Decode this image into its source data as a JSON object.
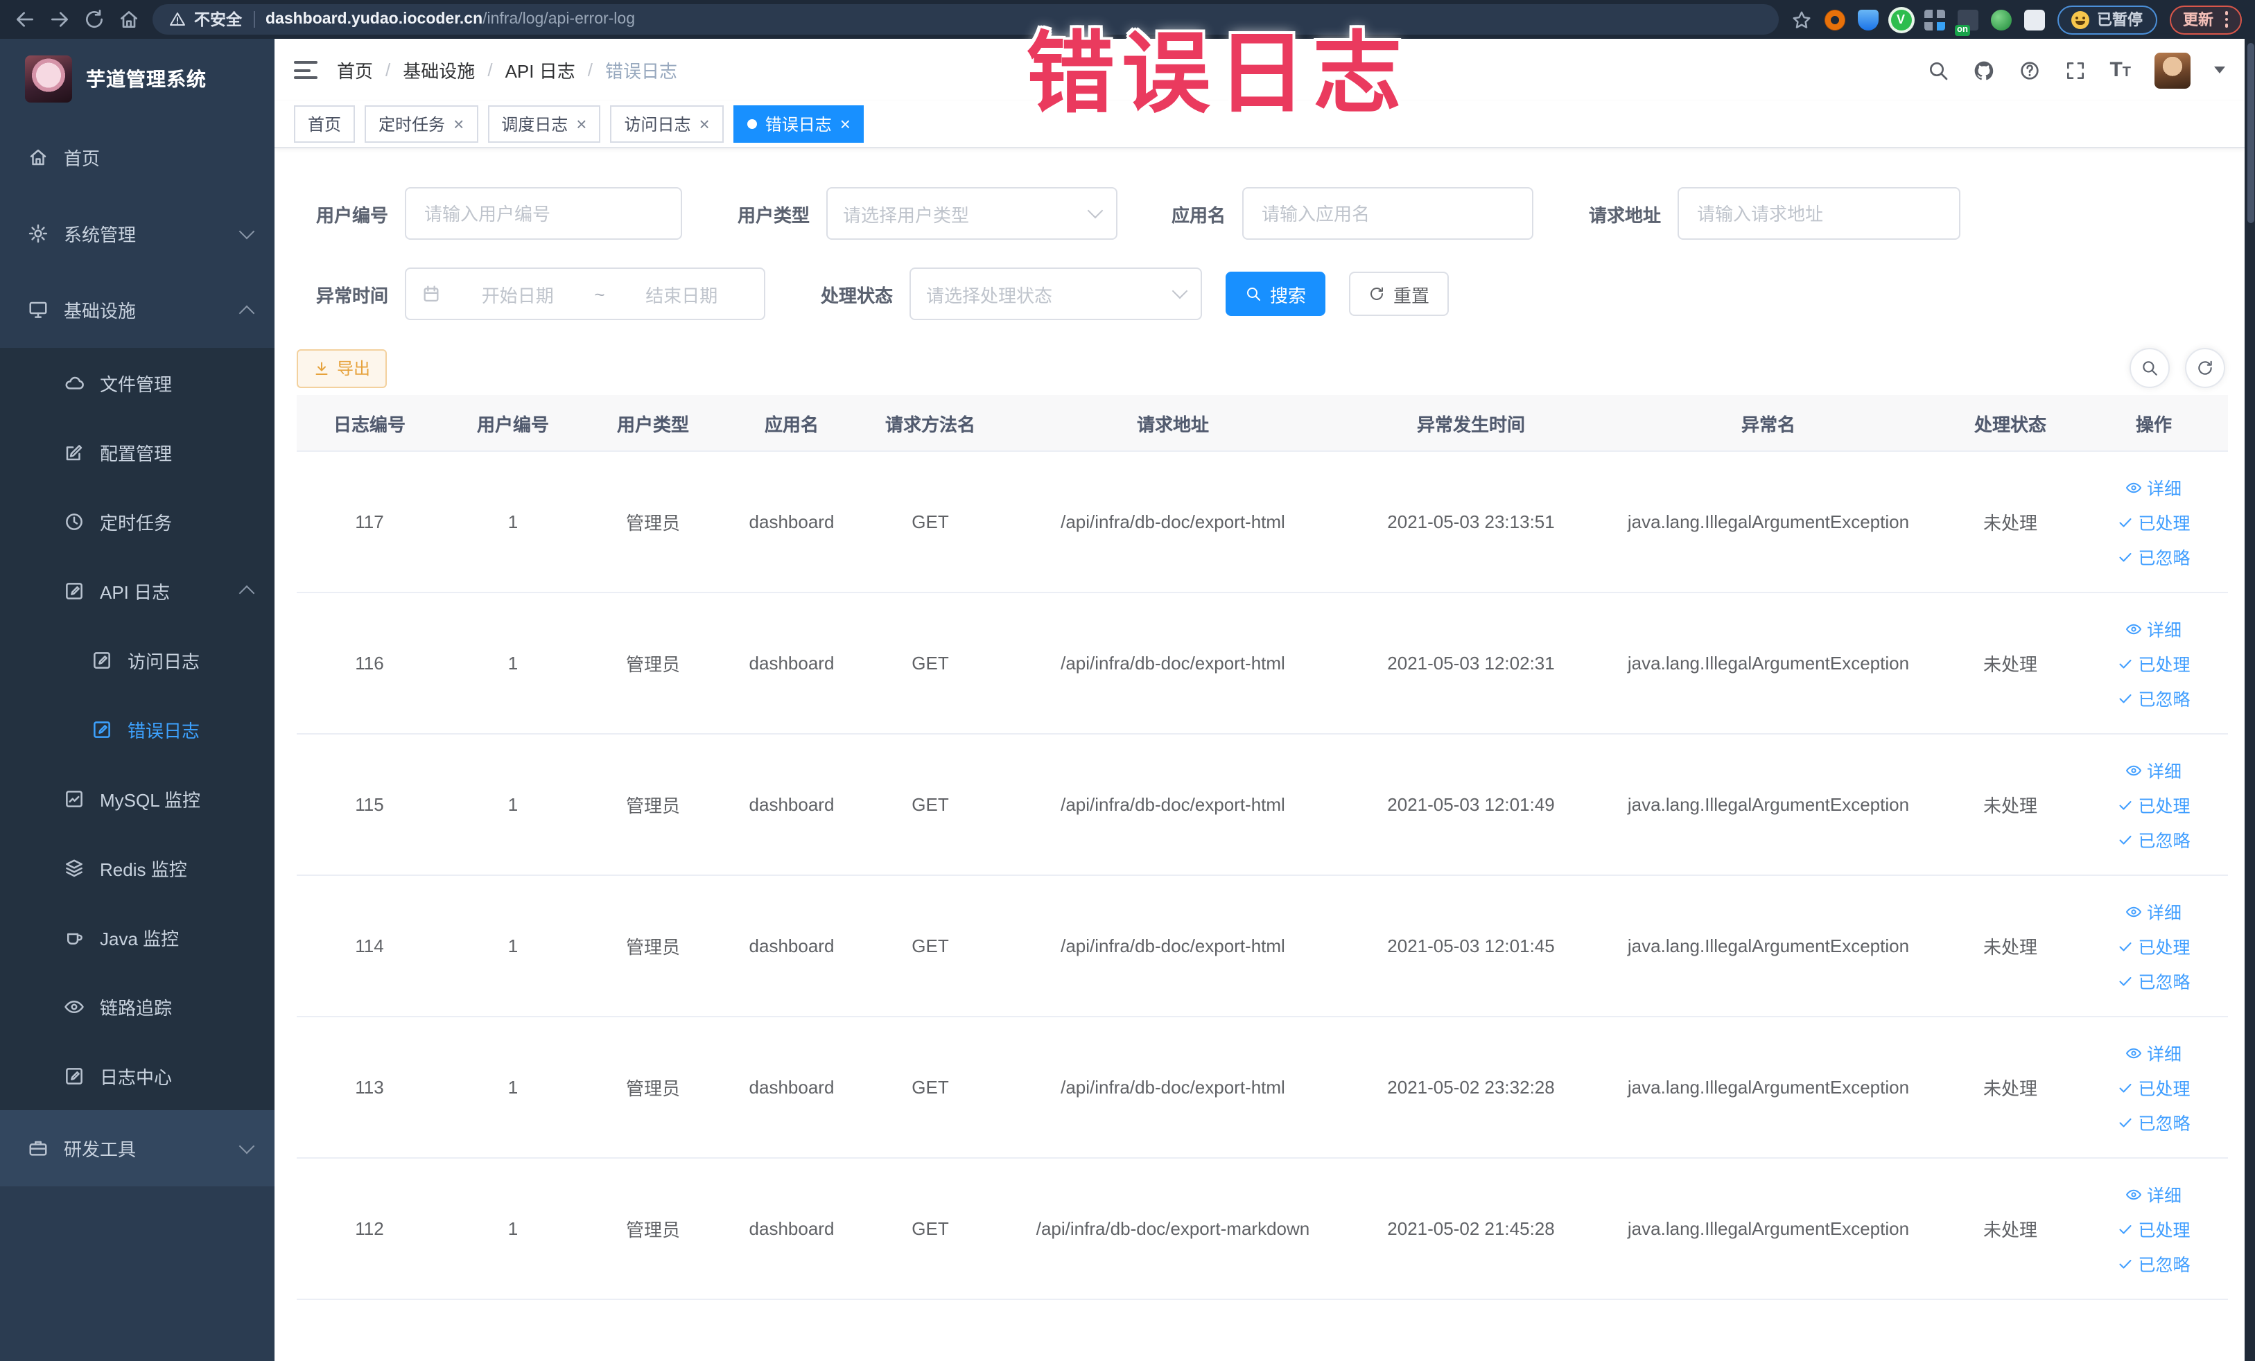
{
  "browser": {
    "security_label": "不安全",
    "url_host": "dashboard.yudao.iocoder.cn",
    "url_path": "/infra/log/api-error-log",
    "extension_badge": "on",
    "paused_label": "已暂停",
    "update_label": "更新"
  },
  "overlay": {
    "text": "错误日志"
  },
  "sidebar": {
    "logo_title": "芋道管理系统",
    "items": [
      {
        "label": "首页"
      },
      {
        "label": "系统管理"
      },
      {
        "label": "基础设施"
      },
      {
        "label": "文件管理"
      },
      {
        "label": "配置管理"
      },
      {
        "label": "定时任务"
      },
      {
        "label": "API 日志"
      },
      {
        "label": "访问日志"
      },
      {
        "label": "错误日志"
      },
      {
        "label": "MySQL 监控"
      },
      {
        "label": "Redis 监控"
      },
      {
        "label": "Java 监控"
      },
      {
        "label": "链路追踪"
      },
      {
        "label": "日志中心"
      },
      {
        "label": "研发工具"
      }
    ]
  },
  "header": {
    "breadcrumb": [
      "首页",
      "基础设施",
      "API 日志",
      "错误日志"
    ]
  },
  "tabs": [
    {
      "label": "首页"
    },
    {
      "label": "定时任务"
    },
    {
      "label": "调度日志"
    },
    {
      "label": "访问日志"
    },
    {
      "label": "错误日志"
    }
  ],
  "filters": {
    "user_id": {
      "label": "用户编号",
      "placeholder": "请输入用户编号",
      "value": ""
    },
    "user_type": {
      "label": "用户类型",
      "placeholder": "请选择用户类型"
    },
    "app_name": {
      "label": "应用名",
      "placeholder": "请输入应用名",
      "value": ""
    },
    "request_url": {
      "label": "请求地址",
      "placeholder": "请输入请求地址",
      "value": ""
    },
    "exception_time": {
      "label": "异常时间",
      "start_placeholder": "开始日期",
      "separator": "~",
      "end_placeholder": "结束日期"
    },
    "process_status": {
      "label": "处理状态",
      "placeholder": "请选择处理状态"
    },
    "search_label": "搜索",
    "reset_label": "重置"
  },
  "toolbar": {
    "export_label": "导出"
  },
  "table": {
    "columns": [
      "日志编号",
      "用户编号",
      "用户类型",
      "应用名",
      "请求方法名",
      "请求地址",
      "异常发生时间",
      "异常名",
      "处理状态",
      "操作"
    ],
    "action_labels": {
      "detail": "详细",
      "processed": "已处理",
      "ignored": "已忽略"
    },
    "rows": [
      {
        "id": "117",
        "user_id": "1",
        "user_type": "管理员",
        "app": "dashboard",
        "method": "GET",
        "url": "/api/infra/db-doc/export-html",
        "time": "2021-05-03 23:13:51",
        "exception": "java.lang.IllegalArgumentException",
        "status": "未处理"
      },
      {
        "id": "116",
        "user_id": "1",
        "user_type": "管理员",
        "app": "dashboard",
        "method": "GET",
        "url": "/api/infra/db-doc/export-html",
        "time": "2021-05-03 12:02:31",
        "exception": "java.lang.IllegalArgumentException",
        "status": "未处理"
      },
      {
        "id": "115",
        "user_id": "1",
        "user_type": "管理员",
        "app": "dashboard",
        "method": "GET",
        "url": "/api/infra/db-doc/export-html",
        "time": "2021-05-03 12:01:49",
        "exception": "java.lang.IllegalArgumentException",
        "status": "未处理"
      },
      {
        "id": "114",
        "user_id": "1",
        "user_type": "管理员",
        "app": "dashboard",
        "method": "GET",
        "url": "/api/infra/db-doc/export-html",
        "time": "2021-05-03 12:01:45",
        "exception": "java.lang.IllegalArgumentException",
        "status": "未处理"
      },
      {
        "id": "113",
        "user_id": "1",
        "user_type": "管理员",
        "app": "dashboard",
        "method": "GET",
        "url": "/api/infra/db-doc/export-html",
        "time": "2021-05-02 23:32:28",
        "exception": "java.lang.IllegalArgumentException",
        "status": "未处理"
      },
      {
        "id": "112",
        "user_id": "1",
        "user_type": "管理员",
        "app": "dashboard",
        "method": "GET",
        "url": "/api/infra/db-doc/export-markdown",
        "time": "2021-05-02 21:45:28",
        "exception": "java.lang.IllegalArgumentException",
        "status": "未处理"
      }
    ]
  },
  "colors": {
    "accent": "#409eff",
    "active_tab": "#1890ff",
    "warning": "#e6a23c",
    "sidebar_bg": "#2b3c51",
    "chrome_bg": "#1e2938",
    "overlay_pink": "#ea3a5e"
  }
}
